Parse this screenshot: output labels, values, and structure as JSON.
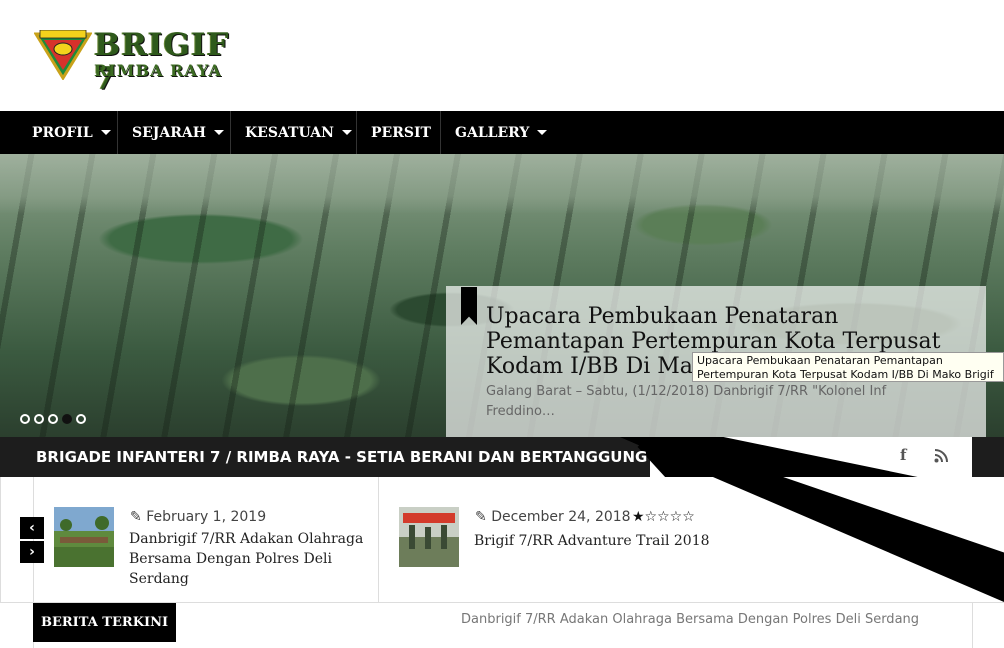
{
  "logo": {
    "title": "BRIGIF 7",
    "subtitle": "RIMBA RAYA",
    "emblem_text": "RIMBA RAYA"
  },
  "nav": {
    "items": [
      {
        "label": "PROFIL",
        "has_dropdown": true
      },
      {
        "label": "SEJARAH",
        "has_dropdown": true
      },
      {
        "label": "KESATUAN",
        "has_dropdown": true
      },
      {
        "label": "PERSIT",
        "has_dropdown": false
      },
      {
        "label": "GALLERY",
        "has_dropdown": true
      }
    ]
  },
  "slider": {
    "title": "Upacara Pembukaan Penataran Pemantapan Pertempuran Kota Terpusat Kodam I/BB Di Mako Brigif 7/RR",
    "excerpt": "Galang Barat – Sabtu, (1/12/2018) Danbrigif 7/RR \"Kolonel Inf Freddino…",
    "tooltip": "Upacara Pembukaan Penataran Pemantapan Pertempuran Kota Terpusat Kodam I/BB Di Mako Brigif 7/RR",
    "dots": 5,
    "active_dot": 4
  },
  "tagline": {
    "text": "BRIGADE INFANTERI 7 / RIMBA RAYA - SETIA BERANI DAN BERTANGGUNG"
  },
  "social": {
    "facebook_icon": "f",
    "rss_icon": "rss"
  },
  "news": [
    {
      "date": "February 1, 2019",
      "title": "Danbrigif 7/RR Adakan Olahraga Bersama Dengan Polres Deli Serdang"
    },
    {
      "date": "December 24, 2018",
      "title": "Brigif 7/RR Advanture Trail 2018",
      "rating": "★☆☆☆☆"
    }
  ],
  "arrows": {
    "prev": "‹",
    "next": "›"
  },
  "berita": {
    "label": "BERITA TERKINI",
    "ticker": "Danbrigif 7/RR Adakan Olahraga Bersama Dengan Polres Deli Serdang"
  },
  "colors": {
    "nav_bg": "#000000",
    "tagline_bg": "#1d1d1d",
    "logo_green": "#2f5a1c"
  }
}
